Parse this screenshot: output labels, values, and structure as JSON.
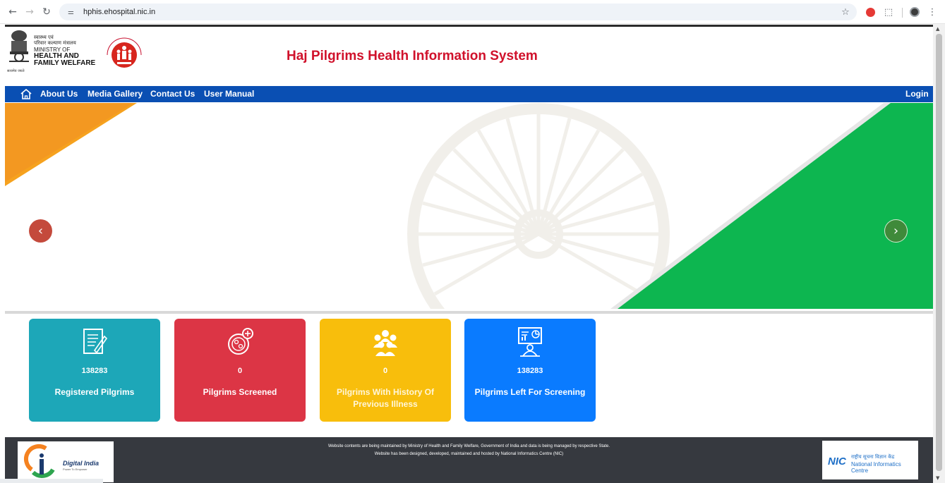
{
  "browser": {
    "url": "hphis.ehospital.nic.in",
    "icons": [
      "back-icon",
      "forward-icon",
      "reload-icon",
      "site-settings-icon",
      "bookmark-star-icon",
      "adblock-icon",
      "extensions-icon",
      "profile-icon",
      "menu-icon"
    ]
  },
  "header": {
    "ministry_hindi_1": "स्वास्थ्य एवं",
    "ministry_hindi_2": "परिवार कल्याण मंत्रालय",
    "ministry_en_1": "MINISTRY OF",
    "ministry_en_2": "HEALTH AND",
    "ministry_en_3": "FAMILY WELFARE",
    "emblem_motto": "सत्यमेव जयते",
    "title": "Haj Pilgrims Health Information System"
  },
  "navbar": {
    "items": [
      "About Us",
      "Media Gallery",
      "Contact Us",
      "User Manual"
    ],
    "login": "Login",
    "color": "#0a4fb3"
  },
  "carousel": {
    "prev_icon": "chevron-left-icon",
    "next_icon": "chevron-right-icon"
  },
  "stats": [
    {
      "value": "138283",
      "label": "Registered Pilgrims",
      "icon": "registration-form-icon",
      "color": "#1da7b8"
    },
    {
      "value": "0",
      "label": "Pilgrims Screened",
      "icon": "screening-cells-icon",
      "color": "#dc3545"
    },
    {
      "value": "0",
      "label": "Pilgrims With History Of Previous Illness",
      "icon": "group-people-icon",
      "color": "#f8be0c"
    },
    {
      "value": "138283",
      "label": "Pilgrims Left For Screening",
      "icon": "presentation-person-icon",
      "color": "#0a7bff"
    }
  ],
  "footer": {
    "line1": "Website contents are being maintained by Ministry of Health and Family Welfare, Government of India and data is being managed by respective State.",
    "line2": "Website has been designed, developed, maintained and hosted by National Informatics Centre (NIC)",
    "digital_india": "Digital India",
    "digital_india_tagline": "Power To Empower",
    "nic_mark": "NIC",
    "nic_hindi": "राष्ट्रीय सूचना विज्ञान केंद्र",
    "nic_english": "National Informatics Centre"
  }
}
